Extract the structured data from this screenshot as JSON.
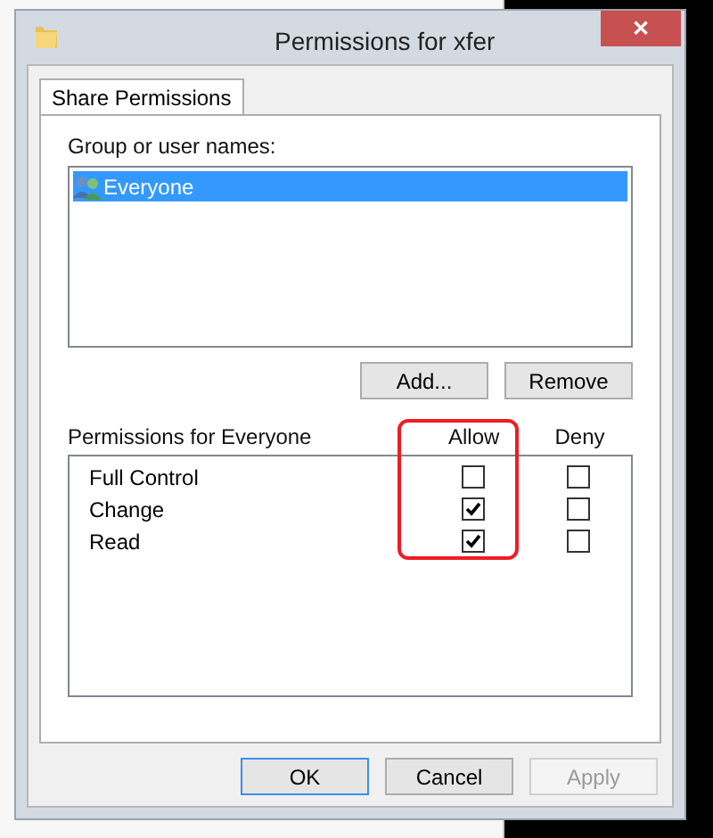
{
  "window": {
    "title": "Permissions for xfer",
    "close": "✕"
  },
  "tabs": [
    {
      "label": "Share Permissions",
      "selected": true
    }
  ],
  "group_label": "Group or user names:",
  "users": [
    {
      "name": "Everyone",
      "selected": true
    }
  ],
  "user_buttons": [
    {
      "label": "Add...",
      "disabled": false
    },
    {
      "label": "Remove",
      "disabled": false
    }
  ],
  "permissions": {
    "label": "Permissions for Everyone",
    "columns": [
      "Allow",
      "Deny"
    ],
    "rows": [
      {
        "name": "Full Control",
        "allow": false,
        "deny": false
      },
      {
        "name": "Change",
        "allow": true,
        "deny": false
      },
      {
        "name": "Read",
        "allow": true,
        "deny": false
      }
    ]
  },
  "buttons": [
    {
      "label": "OK",
      "default": true,
      "disabled": false
    },
    {
      "label": "Cancel",
      "default": false,
      "disabled": false
    },
    {
      "label": "Apply",
      "default": false,
      "disabled": true
    }
  ]
}
